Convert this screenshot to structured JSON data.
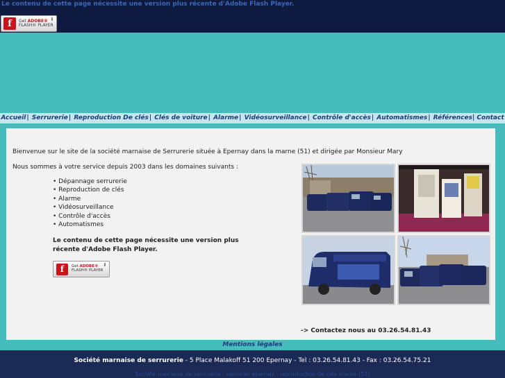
{
  "top": {
    "flash_message": "Le contenu de cette page nécessite une version plus récente d'Adobe Flash Player."
  },
  "flash_badge": {
    "get": "Get",
    "adobe": "ADOBE®",
    "player": "FLASH® PLAYER",
    "logo": "f"
  },
  "nav": {
    "items": [
      "Accueil",
      "Serrurerie",
      "Reproduction De clés",
      "Clés de voiture",
      "Alarme",
      "Vidéosurveillance",
      "Contrôle d'accès",
      "Automatismes",
      "Références",
      "Contact"
    ],
    "separator": "|"
  },
  "content": {
    "welcome": "Bienvenue sur le site de la société marnaise de Serrurerie située à Epernay dans la marne (51) et dirigée par Monsieur Mary",
    "intro": "Nous sommes à votre service depuis 2003 dans les domaines suivants :",
    "services": [
      "Dépannage serrurerie",
      "Reproduction de clés",
      "Alarme",
      "Vidéosurveillance",
      "Contrôle d'accès",
      "Automatismes"
    ],
    "flash_message": "Le contenu de cette page nécessite une version plus récente d'Adobe Flash Player.",
    "contact": "-> Contactez nous au 03.26.54.81.43"
  },
  "mentions": "Mentions légales",
  "footer": {
    "company": "Société marnaise de serrurerie",
    "details": " - 5 Place Malakoff 51 200 Epernay - Tel : 03.26.54.81.43 - Fax : 03.26.54.75.21",
    "seo": "Société marnaise de serrurerie : serrurier epernay - reproduction de clés marne (51)"
  },
  "colors": {
    "top_bar": "#0e1a3f",
    "teal": "#46bdbd",
    "nav_bg": "#c6e6ee",
    "nav_text": "#1c3b7a",
    "content_bg": "#f2f2f2",
    "footer_bg": "#1b2a55"
  }
}
